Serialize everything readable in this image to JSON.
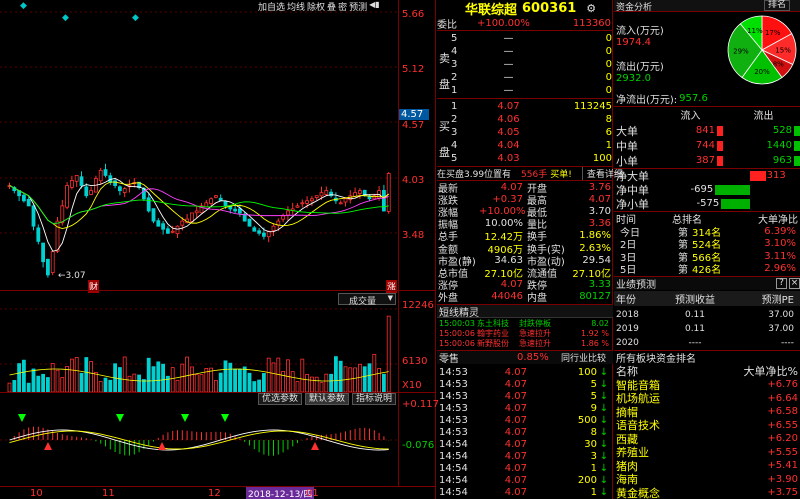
{
  "toolbar": {
    "markers": [
      "◆",
      "◆",
      "◆"
    ],
    "buttons": [
      "加自选",
      "均线",
      "除权",
      "叠",
      "密",
      "预测"
    ],
    "more_icon": "◀▮"
  },
  "price_axis": {
    "labels": [
      "5.66",
      "5.12",
      "4.57",
      "4.03",
      "3.48"
    ],
    "current": "4.57",
    "low_marker": "3.07"
  },
  "volume_axis": {
    "labels": [
      "12246",
      "6130",
      "X10"
    ]
  },
  "indicator_axis": {
    "labels": [
      "0.117",
      "-0.076"
    ]
  },
  "date_axis": {
    "labels": [
      "10",
      "11",
      "12",
      "01"
    ],
    "cursor_date": "2018-12-13/四"
  },
  "badges": {
    "cai": "财",
    "zhang": "涨"
  },
  "volume_panel": {
    "title": "成交量",
    "menu_icon": "▼"
  },
  "indicator_buttons": [
    "优选参数",
    "默认参数",
    "指标说明"
  ],
  "stock": {
    "name": "华联综超",
    "code": "600361",
    "settings_icon": "⚙"
  },
  "weibi": {
    "label": "委比",
    "pct": "+100.00%",
    "diff": "113360"
  },
  "sell_side_label": [
    "卖",
    "盘"
  ],
  "buy_side_label": [
    "买",
    "盘"
  ],
  "sell_rows": [
    {
      "lvl": "5",
      "price": "—",
      "vol": "0"
    },
    {
      "lvl": "4",
      "price": "—",
      "vol": "0"
    },
    {
      "lvl": "3",
      "price": "—",
      "vol": "0"
    },
    {
      "lvl": "2",
      "price": "—",
      "vol": "0"
    },
    {
      "lvl": "1",
      "price": "—",
      "vol": "0"
    }
  ],
  "buy_rows": [
    {
      "lvl": "1",
      "price": "4.07",
      "vol": "113245"
    },
    {
      "lvl": "2",
      "price": "4.06",
      "vol": "8"
    },
    {
      "lvl": "3",
      "price": "4.05",
      "vol": "6"
    },
    {
      "lvl": "4",
      "price": "4.04",
      "vol": "1"
    },
    {
      "lvl": "5",
      "price": "4.03",
      "vol": "100"
    }
  ],
  "queue_bar": {
    "text": "在买盘3.99位置有",
    "count": "556手",
    "action": "买单!",
    "detail": "查看详细"
  },
  "quote": [
    {
      "l": "最新",
      "lv": "4.07",
      "lc": "r",
      "r": "开盘",
      "rv": "3.76",
      "rc": "r"
    },
    {
      "l": "涨跌",
      "lv": "+0.37",
      "lc": "r",
      "r": "最高",
      "rv": "4.07",
      "rc": "r"
    },
    {
      "l": "涨幅",
      "lv": "+10.00%",
      "lc": "r",
      "r": "最低",
      "rv": "3.70",
      "rc": "w"
    },
    {
      "l": "振幅",
      "lv": "10.00%",
      "lc": "w",
      "r": "量比",
      "rv": "3.36",
      "rc": "r"
    },
    {
      "l": "总手",
      "lv": "12.42万",
      "lc": "y",
      "r": "换手",
      "rv": "1.86%",
      "rc": "y"
    },
    {
      "l": "金额",
      "lv": "4906万",
      "lc": "y",
      "r": "换手(实)",
      "rv": "2.63%",
      "rc": "y"
    },
    {
      "l": "市盈(静)",
      "lv": "34.63",
      "lc": "w",
      "r": "市盈(动)",
      "rv": "29.54",
      "rc": "w"
    },
    {
      "l": "总市值",
      "lv": "27.10亿",
      "lc": "y",
      "r": "流通值",
      "rv": "27.10亿",
      "rc": "y"
    },
    {
      "l": "涨停",
      "lv": "4.07",
      "lc": "r",
      "r": "跌停",
      "rv": "3.33",
      "rc": "g"
    },
    {
      "l": "外盘",
      "lv": "44046",
      "lc": "r",
      "r": "内盘",
      "rv": "80127",
      "rc": "g"
    }
  ],
  "sprite": {
    "title": "短线精灵",
    "rows": [
      {
        "time": "15:00:03",
        "name": "东土科技",
        "event": "封跌停板",
        "val": "8.02",
        "c": "g"
      },
      {
        "time": "15:00:06",
        "name": "翰宇药业",
        "event": "急速拉升",
        "val": "1.92 %",
        "c": "r"
      },
      {
        "time": "15:00:06",
        "name": "新野股份",
        "event": "急速拉升",
        "val": "1.86 %",
        "c": "r"
      }
    ]
  },
  "ticks_header": {
    "title": "零售",
    "pct": "0.85%",
    "compare": "同行业比较"
  },
  "ticks": [
    {
      "t": "14:53",
      "p": "4.07",
      "v": "100",
      "arrow": "↓"
    },
    {
      "t": "14:53",
      "p": "4.07",
      "v": "5",
      "arrow": "↓"
    },
    {
      "t": "14:53",
      "p": "4.07",
      "v": "5",
      "arrow": "↓"
    },
    {
      "t": "14:53",
      "p": "4.07",
      "v": "9",
      "arrow": "↓"
    },
    {
      "t": "14:53",
      "p": "4.07",
      "v": "500",
      "arrow": "↓"
    },
    {
      "t": "14:53",
      "p": "4.07",
      "v": "8",
      "arrow": "↓"
    },
    {
      "t": "14:54",
      "p": "4.07",
      "v": "30",
      "arrow": "↓"
    },
    {
      "t": "14:54",
      "p": "4.07",
      "v": "3",
      "arrow": "↓"
    },
    {
      "t": "14:54",
      "p": "4.07",
      "v": "1",
      "arrow": "↓"
    },
    {
      "t": "14:54",
      "p": "4.07",
      "v": "200",
      "arrow": "↓"
    },
    {
      "t": "14:54",
      "p": "4.07",
      "v": "1",
      "arrow": "↓"
    }
  ],
  "funds": {
    "tab_active": "资金分析",
    "tab_other": "排名",
    "inflow_label": "流入(万元)",
    "inflow_value": "1974.4",
    "outflow_label": "流出(万元)",
    "outflow_value": "2932.0",
    "net_label": "净流出(万元):",
    "net_value": "957.6",
    "pie_labels": [
      "17%",
      "15%",
      "8%",
      "20%",
      "29%",
      "11%"
    ]
  },
  "flow_table": {
    "headers": [
      "流入",
      "流出"
    ],
    "rows": [
      {
        "label": "大单",
        "in": "841",
        "out": "528"
      },
      {
        "label": "中单",
        "in": "744",
        "out": "1440"
      },
      {
        "label": "小单",
        "in": "387",
        "out": "963"
      }
    ]
  },
  "net_bars": [
    {
      "label": "净大单",
      "value": "313"
    },
    {
      "label": "净中单",
      "value": "-695"
    },
    {
      "label": "净小单",
      "value": "-575"
    }
  ],
  "rank_table": {
    "headers": [
      "时间",
      "总排名",
      "大单净比"
    ],
    "rows": [
      {
        "d": "今日",
        "prefix": "第",
        "rank": "314名",
        "pct": "6.39%"
      },
      {
        "d": "2日",
        "prefix": "第",
        "rank": "524名",
        "pct": "3.10%"
      },
      {
        "d": "3日",
        "prefix": "第",
        "rank": "566名",
        "pct": "3.11%"
      },
      {
        "d": "5日",
        "prefix": "第",
        "rank": "426名",
        "pct": "2.96%"
      }
    ]
  },
  "forecast": {
    "title": "业绩预测",
    "headers": [
      "年份",
      "预测收益",
      "预测PE"
    ],
    "rows": [
      {
        "y": "2018",
        "e": "0.11",
        "pe": "37.00"
      },
      {
        "y": "2019",
        "e": "0.11",
        "pe": "37.00"
      },
      {
        "y": "2020",
        "e": "----",
        "pe": "----"
      }
    ]
  },
  "sector": {
    "title": "所有板块资金排名",
    "headers": [
      "名称",
      "大单净比%"
    ],
    "rows": [
      {
        "n": "智能音箱",
        "v": "+6.76"
      },
      {
        "n": "机场航运",
        "v": "+6.64"
      },
      {
        "n": "摘帽",
        "v": "+6.58"
      },
      {
        "n": "语音技术",
        "v": "+6.55"
      },
      {
        "n": "西藏",
        "v": "+6.20"
      },
      {
        "n": "养殖业",
        "v": "+5.55"
      },
      {
        "n": "猪肉",
        "v": "+5.41"
      },
      {
        "n": "海南",
        "v": "+3.90"
      },
      {
        "n": "黄金概念",
        "v": "+3.75"
      }
    ]
  }
}
